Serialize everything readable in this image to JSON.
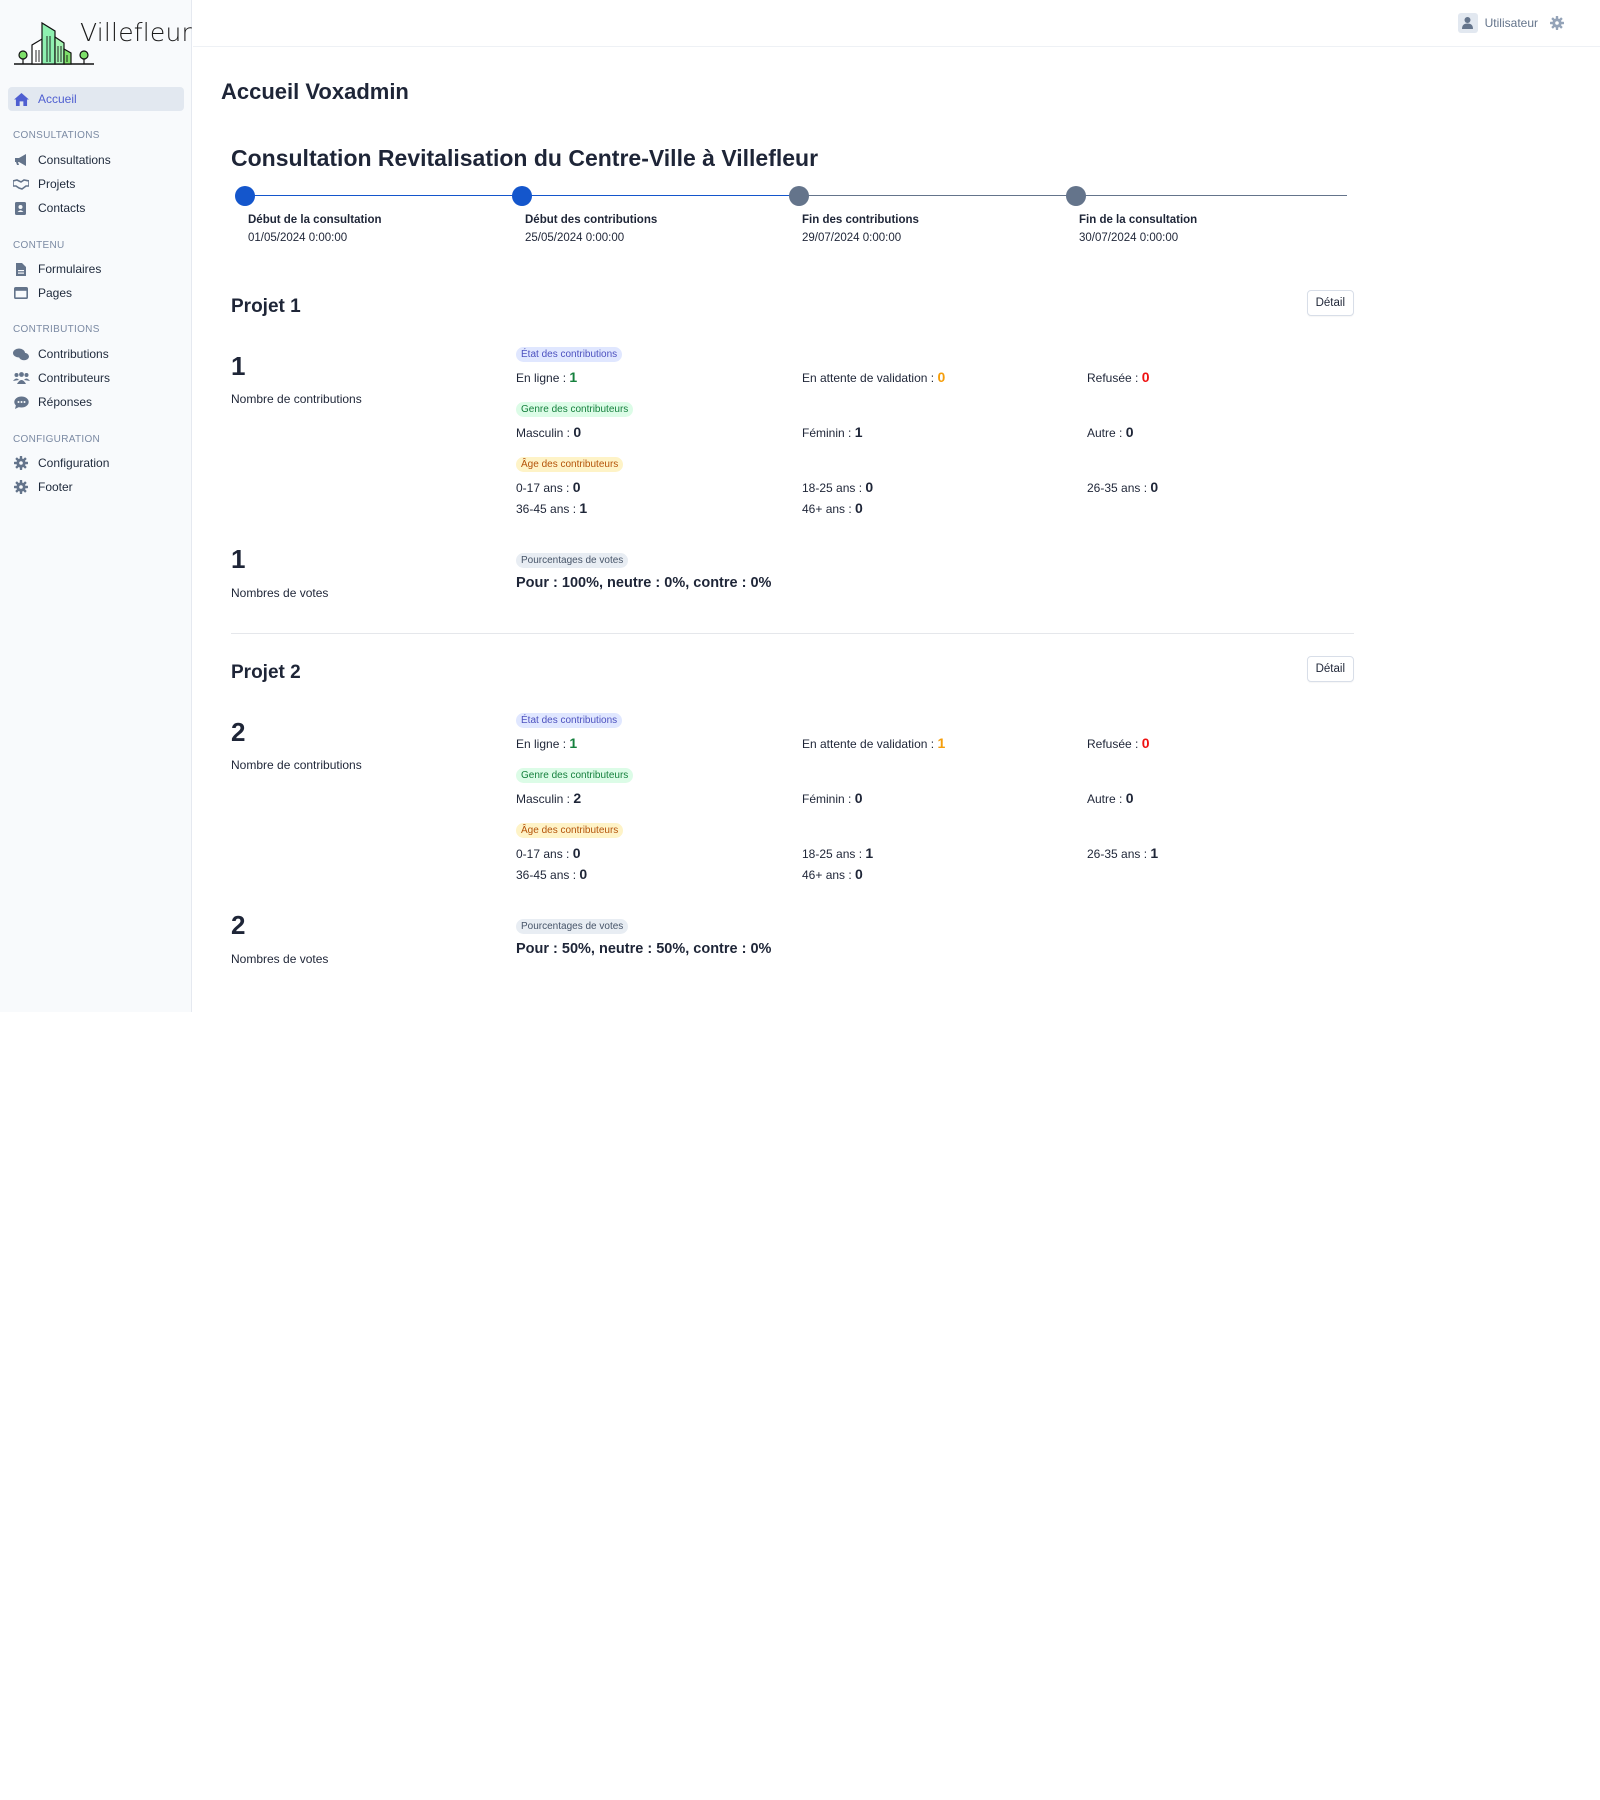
{
  "brand": {
    "name": "Villefleur"
  },
  "header": {
    "user_label": "Utilisateur"
  },
  "sidebar": {
    "active": {
      "label": "Accueil",
      "icon": "home-icon"
    },
    "sections": [
      {
        "title": "Consultations",
        "items": [
          {
            "label": "Consultations",
            "icon": "megaphone-icon"
          },
          {
            "label": "Projets",
            "icon": "handshake-icon"
          },
          {
            "label": "Contacts",
            "icon": "address-book-icon"
          }
        ]
      },
      {
        "title": "Contenu",
        "items": [
          {
            "label": "Formulaires",
            "icon": "file-icon"
          },
          {
            "label": "Pages",
            "icon": "window-icon"
          }
        ]
      },
      {
        "title": "Contributions",
        "items": [
          {
            "label": "Contributions",
            "icon": "comments-icon"
          },
          {
            "label": "Contributeurs",
            "icon": "users-icon"
          },
          {
            "label": "Réponses",
            "icon": "comment-dots-icon"
          }
        ]
      },
      {
        "title": "Configuration",
        "items": [
          {
            "label": "Configuration",
            "icon": "gear-icon"
          },
          {
            "label": "Footer",
            "icon": "gear-icon"
          }
        ]
      }
    ]
  },
  "main": {
    "page_title": "Accueil Voxadmin",
    "consultation_title": "Consultation Revitalisation du Centre-Ville à Villefleur",
    "timeline": [
      {
        "label": "Début de la consultation",
        "date": "01/05/2024 0:00:00",
        "reached": true
      },
      {
        "label": "Début des contributions",
        "date": "25/05/2024 0:00:00",
        "reached": true
      },
      {
        "label": "Fin des contributions",
        "date": "29/07/2024 0:00:00",
        "reached": false
      },
      {
        "label": "Fin de la consultation",
        "date": "30/07/2024 0:00:00",
        "reached": false
      }
    ],
    "colors": {
      "reached": "#1456cc",
      "pending": "#64748b"
    },
    "detail_label": "Détail",
    "labels": {
      "contributions_count": "Nombre de contributions",
      "votes_count": "Nombres de votes",
      "badge_state": "État des contributions",
      "badge_gender": "Genre des contributeurs",
      "badge_age": "Âge des contributeurs",
      "badge_votes": "Pourcentages de votes",
      "online": "En ligne : ",
      "pending": "En attente de validation : ",
      "refused": "Refusée : ",
      "male": "Masculin : ",
      "female": "Féminin : ",
      "other": "Autre : ",
      "age_0_17": "0-17 ans : ",
      "age_18_25": "18-25 ans : ",
      "age_26_35": "26-35 ans : ",
      "age_36_45": "36-45 ans : ",
      "age_46": "46+ ans : "
    },
    "projects": [
      {
        "title": "Projet 1",
        "contributions": "1",
        "state": {
          "online": "1",
          "pending": "0",
          "refused": "0"
        },
        "gender": {
          "male": "0",
          "female": "1",
          "other": "0"
        },
        "age": {
          "a0_17": "0",
          "a18_25": "0",
          "a26_35": "0",
          "a36_45": "1",
          "a46": "0"
        },
        "votes": "1",
        "vote_percentages": "Pour : 100%, neutre : 0%, contre : 0%"
      },
      {
        "title": "Projet 2",
        "contributions": "2",
        "state": {
          "online": "1",
          "pending": "1",
          "refused": "0"
        },
        "gender": {
          "male": "2",
          "female": "0",
          "other": "0"
        },
        "age": {
          "a0_17": "0",
          "a18_25": "1",
          "a26_35": "1",
          "a36_45": "0",
          "a46": "0"
        },
        "votes": "2",
        "vote_percentages": "Pour : 50%, neutre : 50%, contre : 0%"
      }
    ]
  }
}
